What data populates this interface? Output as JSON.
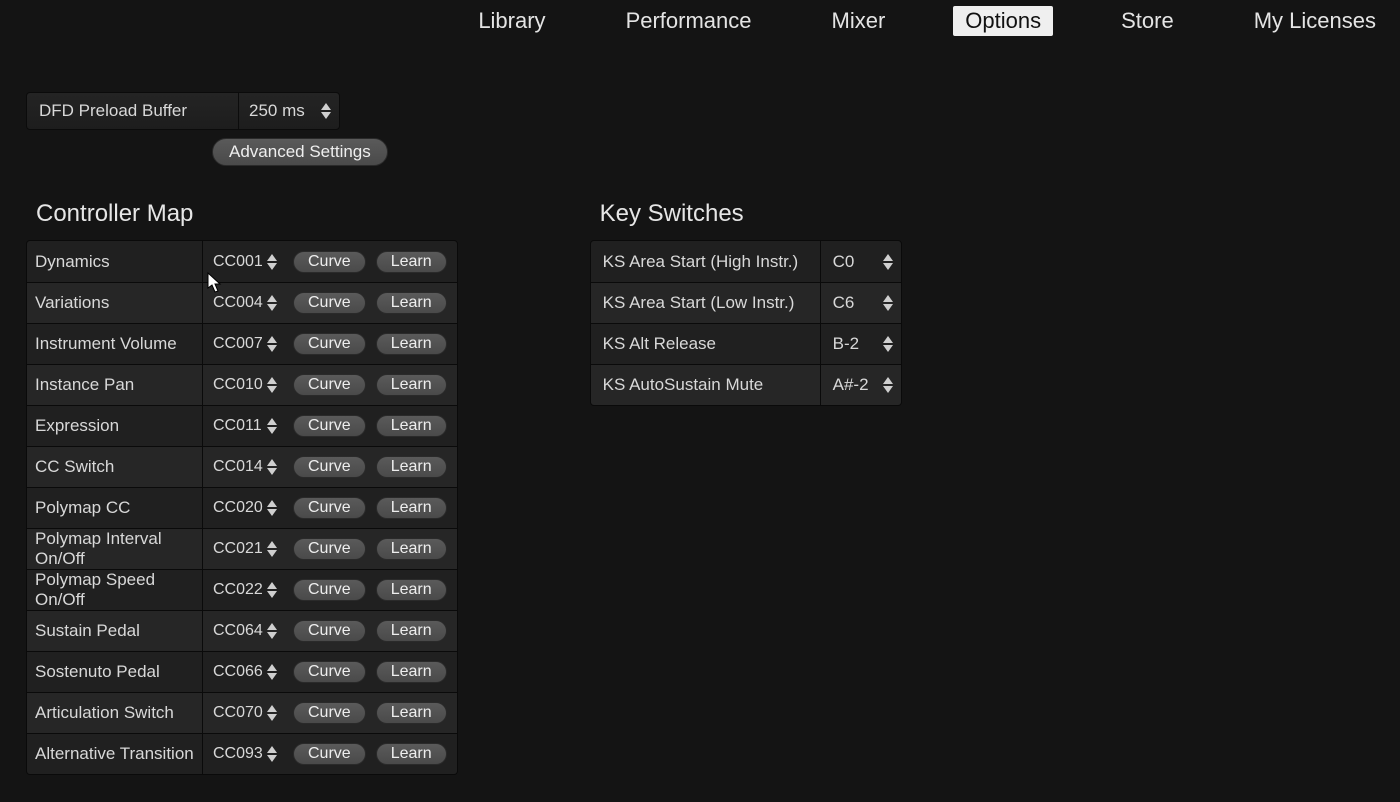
{
  "nav": {
    "items": [
      {
        "label": "Library",
        "active": false
      },
      {
        "label": "Performance",
        "active": false
      },
      {
        "label": "Mixer",
        "active": false
      },
      {
        "label": "Options",
        "active": true
      },
      {
        "label": "Store",
        "active": false
      },
      {
        "label": "My Licenses",
        "active": false
      }
    ]
  },
  "dfd": {
    "label": "DFD Preload Buffer",
    "value": "250 ms",
    "advanced_label": "Advanced Settings"
  },
  "controller_map": {
    "title": "Controller Map",
    "curve_label": "Curve",
    "learn_label": "Learn",
    "rows": [
      {
        "label": "Dynamics",
        "cc": "CC001"
      },
      {
        "label": "Variations",
        "cc": "CC004"
      },
      {
        "label": "Instrument Volume",
        "cc": "CC007"
      },
      {
        "label": "Instance Pan",
        "cc": "CC010"
      },
      {
        "label": "Expression",
        "cc": "CC011"
      },
      {
        "label": "CC Switch",
        "cc": "CC014"
      },
      {
        "label": "Polymap CC",
        "cc": "CC020"
      },
      {
        "label": "Polymap Interval On/Off",
        "cc": "CC021"
      },
      {
        "label": "Polymap Speed On/Off",
        "cc": "CC022"
      },
      {
        "label": "Sustain Pedal",
        "cc": "CC064"
      },
      {
        "label": "Sostenuto Pedal",
        "cc": "CC066"
      },
      {
        "label": "Articulation Switch",
        "cc": "CC070"
      },
      {
        "label": "Alternative Transition",
        "cc": "CC093"
      }
    ]
  },
  "key_switches": {
    "title": "Key Switches",
    "rows": [
      {
        "label": "KS Area Start (High Instr.)",
        "note": "C0"
      },
      {
        "label": "KS Area Start (Low  Instr.)",
        "note": "C6"
      },
      {
        "label": "KS Alt Release",
        "note": "B-2"
      },
      {
        "label": "KS AutoSustain Mute",
        "note": "A#-2"
      }
    ]
  }
}
